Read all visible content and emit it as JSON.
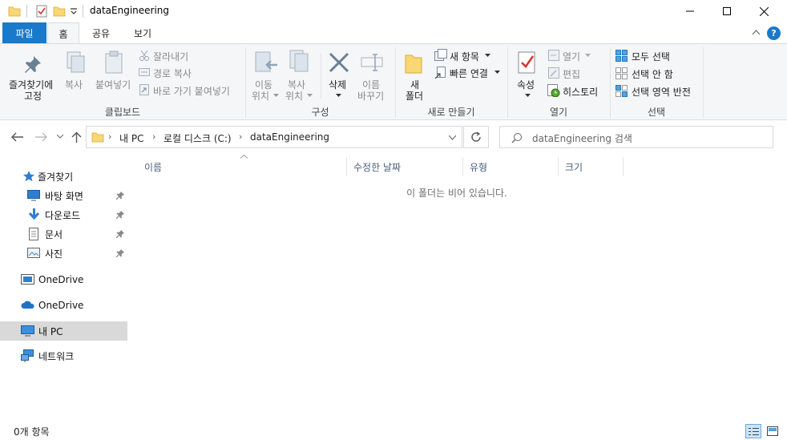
{
  "window": {
    "title": "dataEngineering",
    "minimize_glyph": "—",
    "maximize_glyph": "☐",
    "close_glyph": "✕"
  },
  "tabs": {
    "file": "파일",
    "home": "홈",
    "share": "공유",
    "view": "보기"
  },
  "ribbon": {
    "clipboard": {
      "pin_line1": "즐겨찾기에",
      "pin_line2": "고정",
      "copy": "복사",
      "paste": "붙여넣기",
      "cut": "잘라내기",
      "copy_path": "경로 복사",
      "paste_shortcut": "바로 가기 붙여넣기",
      "label": "클립보드"
    },
    "organize": {
      "move_line1": "이동",
      "move_line2": "위치",
      "copyto_line1": "복사",
      "copyto_line2": "위치",
      "delete": "삭제",
      "rename_line1": "이름",
      "rename_line2": "바꾸기",
      "label": "구성"
    },
    "new": {
      "folder_line1": "새",
      "folder_line2": "폴더",
      "new_item": "새 항목",
      "easy_access": "빠른 연결",
      "label": "새로 만들기"
    },
    "open": {
      "properties": "속성",
      "open": "열기",
      "edit": "편집",
      "history": "히스토리",
      "label": "열기"
    },
    "select": {
      "select_all": "모두 선택",
      "select_none": "선택 안 함",
      "invert": "선택 영역 반전",
      "label": "선택"
    }
  },
  "address": {
    "crumbs": [
      "내 PC",
      "로컬 디스크 (C:)",
      "dataEngineering"
    ],
    "search_placeholder": "dataEngineering 검색"
  },
  "nav": {
    "quick_access": "즐겨찾기",
    "desktop": "바탕 화면",
    "downloads": "다운로드",
    "documents": "문서",
    "pictures": "사진",
    "onedrive1": "OneDrive",
    "onedrive2": "OneDrive",
    "this_pc": "내 PC",
    "network": "네트워크"
  },
  "columns": {
    "name": "이름",
    "modified": "수정한 날짜",
    "type": "유형",
    "size": "크기"
  },
  "content": {
    "empty_message": "이 폴더는 비어 있습니다."
  },
  "status": {
    "item_count": "0개 항목"
  },
  "colors": {
    "accent": "#1979ca",
    "ribbon_bg": "#f5f6f7",
    "selected_nav": "#d9d9d9",
    "folder_yellow": "#f8d775"
  }
}
